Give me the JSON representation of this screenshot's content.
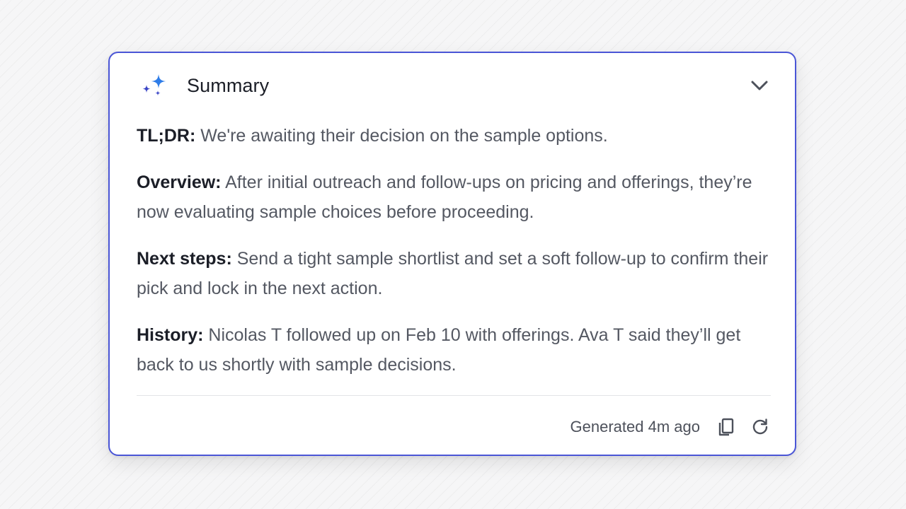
{
  "summary": {
    "title": "Summary",
    "icon": "sparkle-icon",
    "collapse_icon": "chevron-down-icon",
    "accent_color": "#4a55d6",
    "sections": [
      {
        "label": "TL;DR:",
        "text": "We're awaiting their decision on the sample options."
      },
      {
        "label": "Overview:",
        "text": "After initial outreach and follow-ups on pricing and offerings, they’re now evaluating sample choices before proceeding."
      },
      {
        "label": "Next steps:",
        "text": "Send a tight sample shortlist and set a soft follow-up to confirm their pick and lock in the next action."
      },
      {
        "label": "History:",
        "text": "Nicolas T followed up on Feb 10 with offerings. Ava T said they’ll get back to us shortly with sample decisions."
      }
    ],
    "footer": {
      "generated_text": "Generated 4m ago",
      "copy_icon": "copy-icon",
      "refresh_icon": "refresh-icon"
    }
  }
}
